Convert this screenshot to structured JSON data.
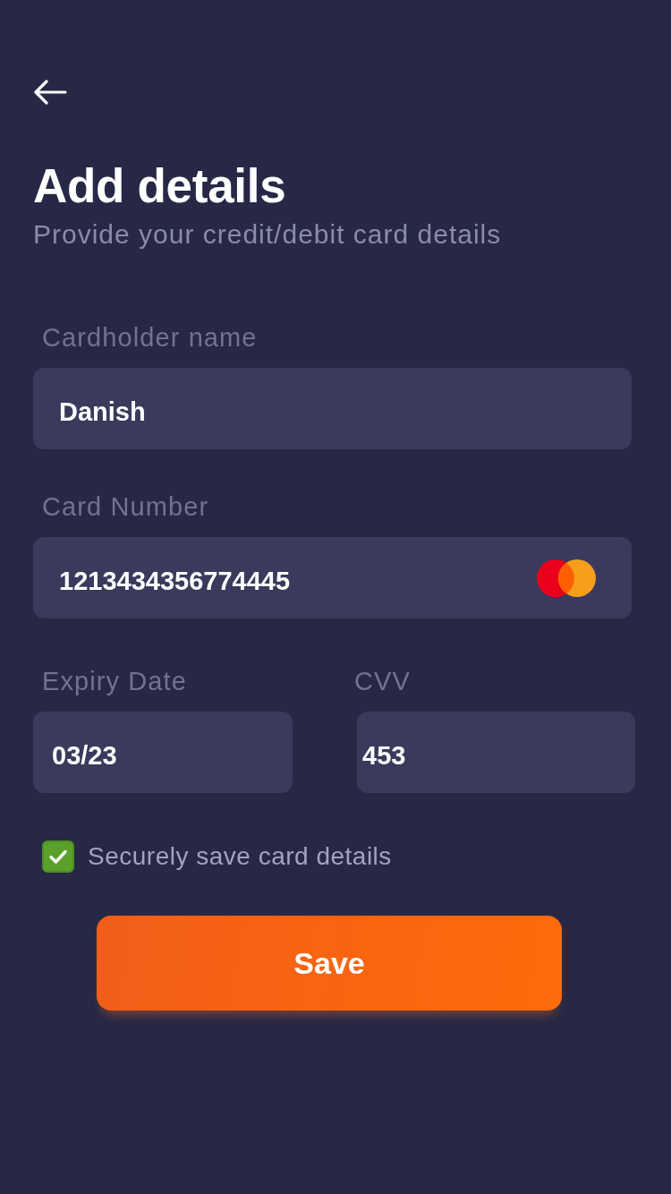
{
  "header": {
    "title": "Add details",
    "subtitle": "Provide your credit/debit card details"
  },
  "fields": [
    {
      "kind": "text",
      "label": "Cardholder name",
      "value": "Danish"
    },
    {
      "kind": "card",
      "label": "Card Number",
      "value": "1213434356774445"
    }
  ],
  "row_fields": [
    {
      "label": "Expiry Date",
      "value": "03/23"
    },
    {
      "label": "CVV",
      "value": "453"
    }
  ],
  "save_option": {
    "label": "Securely save card details",
    "checked": true
  },
  "button": {
    "label": "Save"
  }
}
